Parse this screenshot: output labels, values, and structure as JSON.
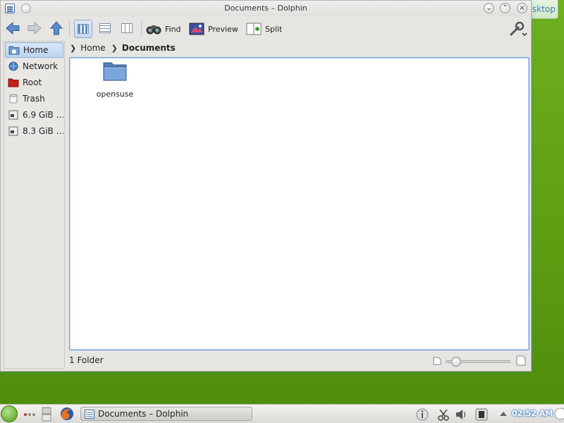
{
  "desktop": {
    "widget_label": "sktop"
  },
  "window": {
    "title": "Documents – Dolphin"
  },
  "toolbar": {
    "find_label": "Find",
    "preview_label": "Preview",
    "split_label": "Split"
  },
  "breadcrumb": {
    "items": [
      "Home",
      "Documents"
    ]
  },
  "places": {
    "items": [
      {
        "label": "Home",
        "icon": "home-folder-icon",
        "selected": true
      },
      {
        "label": "Network",
        "icon": "network-icon"
      },
      {
        "label": "Root",
        "icon": "red-folder-icon"
      },
      {
        "label": "Trash",
        "icon": "trash-icon"
      },
      {
        "label": "6.9 GiB …",
        "icon": "drive-icon"
      },
      {
        "label": "8.3 GiB …",
        "icon": "drive-icon"
      }
    ]
  },
  "content": {
    "items": [
      {
        "name": "opensuse",
        "type": "folder"
      }
    ]
  },
  "status": {
    "text": "1 Folder",
    "zoom_fraction": 0.1
  },
  "taskbar": {
    "task_label": "Documents – Dolphin",
    "clock": "02:52 AM"
  },
  "colors": {
    "selection": "#bcd4ee",
    "content_border": "#6aa2d8",
    "desktop_green": "#5e9e12"
  }
}
